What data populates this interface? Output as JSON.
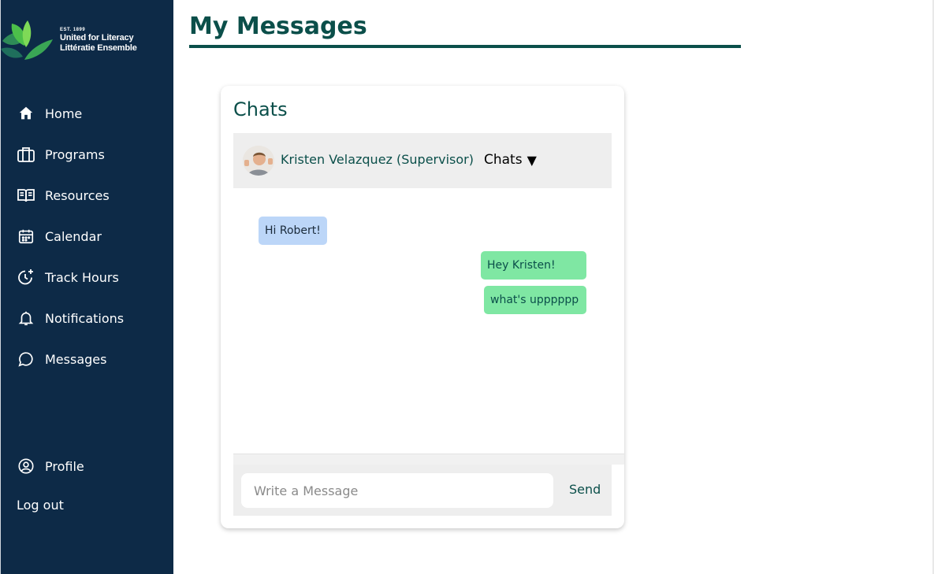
{
  "brand": {
    "est": "EST. 1899",
    "line1": "United for Literacy",
    "line2": "Littératie Ensemble"
  },
  "nav": [
    {
      "label": "Home",
      "icon": "home-icon"
    },
    {
      "label": "Programs",
      "icon": "briefcase-icon"
    },
    {
      "label": "Resources",
      "icon": "book-icon"
    },
    {
      "label": "Calendar",
      "icon": "calendar-icon"
    },
    {
      "label": "Track Hours",
      "icon": "clock-plus-icon"
    },
    {
      "label": "Notifications",
      "icon": "bell-icon"
    },
    {
      "label": "Messages",
      "icon": "chat-bubble-icon"
    }
  ],
  "profile": {
    "label": "Profile",
    "icon": "user-circle-icon"
  },
  "logout": "Log out",
  "page": {
    "title": "My Messages"
  },
  "chat": {
    "title": "Chats",
    "contact": "Kristen Velazquez (Supervisor)",
    "dropdown_label": "Chats",
    "messages": [
      {
        "text": "Hi Robert!",
        "direction": "in"
      },
      {
        "text": "Hey Kristen!",
        "direction": "out"
      },
      {
        "text": "what's upppppp",
        "direction": "out"
      }
    ],
    "input_placeholder": "Write a Message",
    "send_label": "Send"
  },
  "colors": {
    "sidebar_bg": "#0d2a47",
    "accent": "#0b4f4a",
    "bubble_in": "#bcd6f8",
    "bubble_out": "#7fe7a3"
  }
}
